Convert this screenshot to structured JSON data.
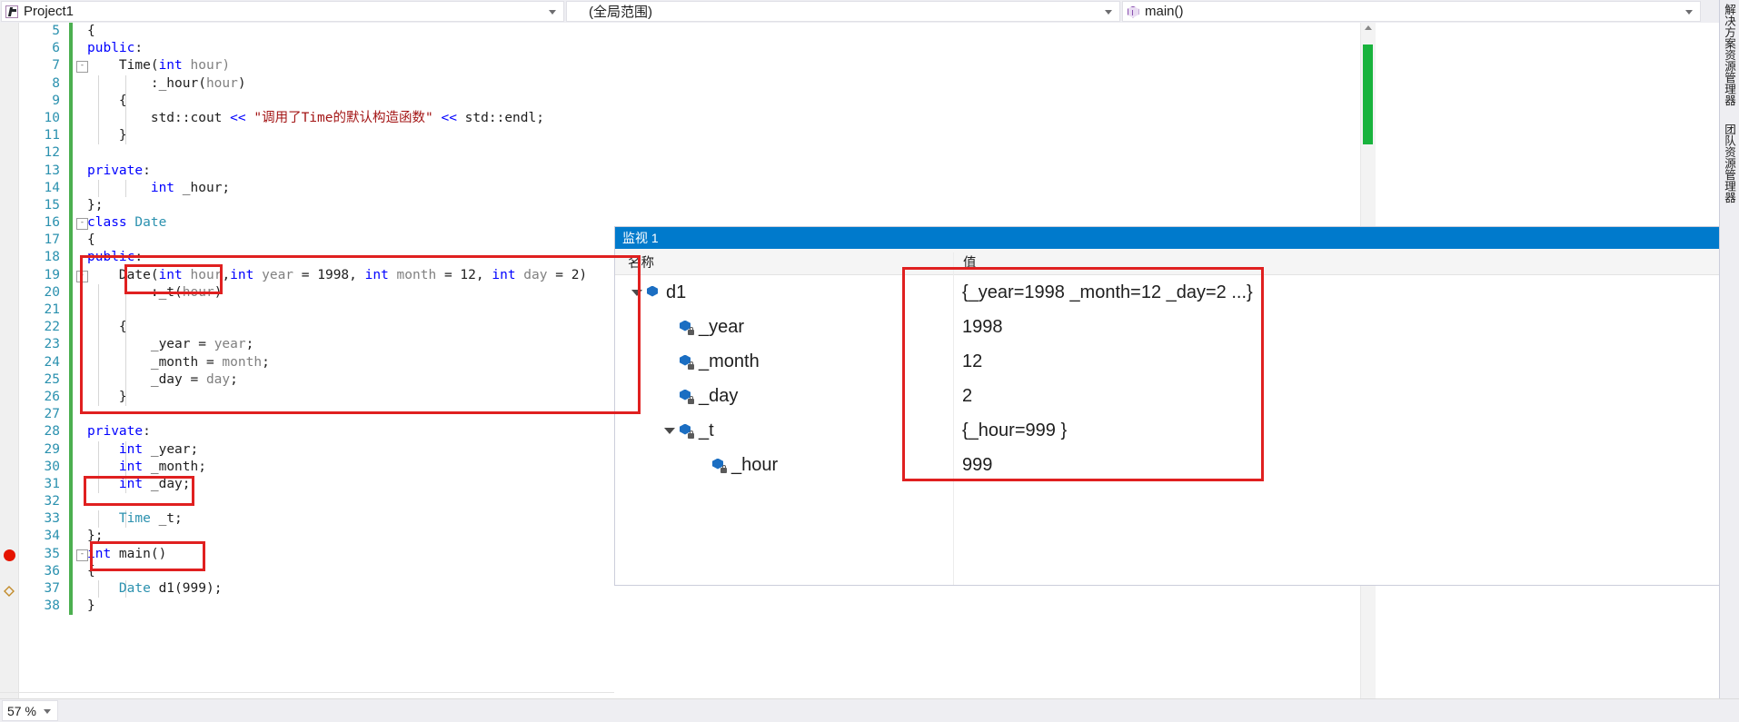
{
  "navbar": {
    "project": {
      "label": "Project1",
      "icon": "project-icon"
    },
    "scope": {
      "label": "(全局范围)"
    },
    "member": {
      "label": "main()",
      "icon": "method-cube-icon"
    }
  },
  "editor": {
    "first_line_number": 5,
    "lines": [
      {
        "num": 5,
        "indent": 0,
        "fold": "",
        "tokens": [
          {
            "t": "{",
            "c": "n"
          }
        ]
      },
      {
        "num": 6,
        "indent": 0,
        "fold": "",
        "tokens": [
          {
            "t": "public",
            "c": "k"
          },
          {
            "t": ":",
            "c": "n"
          }
        ]
      },
      {
        "num": 7,
        "indent": 0,
        "fold": "-",
        "tokens": [
          {
            "t": "    Time(",
            "c": "n"
          },
          {
            "t": "int",
            "c": "k"
          },
          {
            "t": " hour)",
            "c": "id"
          }
        ]
      },
      {
        "num": 8,
        "indent": 1,
        "fold": "",
        "tokens": [
          {
            "t": "        :_hour(",
            "c": "n"
          },
          {
            "t": "hour",
            "c": "id"
          },
          {
            "t": ")",
            "c": "n"
          }
        ]
      },
      {
        "num": 9,
        "indent": 1,
        "fold": "",
        "tokens": [
          {
            "t": "    {",
            "c": "n"
          }
        ]
      },
      {
        "num": 10,
        "indent": 1,
        "fold": "",
        "tokens": [
          {
            "t": "        std::cout ",
            "c": "n"
          },
          {
            "t": "<<",
            "c": "k"
          },
          {
            "t": " ",
            "c": "n"
          },
          {
            "t": "\"调用了Time的默认构造函数\"",
            "c": "s"
          },
          {
            "t": " ",
            "c": "n"
          },
          {
            "t": "<<",
            "c": "k"
          },
          {
            "t": " std::endl;",
            "c": "n"
          }
        ]
      },
      {
        "num": 11,
        "indent": 1,
        "fold": "",
        "tokens": [
          {
            "t": "    }",
            "c": "n"
          }
        ]
      },
      {
        "num": 12,
        "indent": 0,
        "fold": "",
        "tokens": []
      },
      {
        "num": 13,
        "indent": 0,
        "fold": "",
        "tokens": [
          {
            "t": "private",
            "c": "k"
          },
          {
            "t": ":",
            "c": "n"
          }
        ]
      },
      {
        "num": 14,
        "indent": 1,
        "fold": "",
        "tokens": [
          {
            "t": "        ",
            "c": "n"
          },
          {
            "t": "int",
            "c": "k"
          },
          {
            "t": " _hour;",
            "c": "n"
          }
        ]
      },
      {
        "num": 15,
        "indent": 0,
        "fold": "",
        "tokens": [
          {
            "t": "};",
            "c": "n"
          }
        ]
      },
      {
        "num": 16,
        "indent": 0,
        "fold": "-",
        "tokens": [
          {
            "t": "class",
            "c": "k"
          },
          {
            "t": " ",
            "c": "n"
          },
          {
            "t": "Date",
            "c": "t"
          }
        ]
      },
      {
        "num": 17,
        "indent": 0,
        "fold": "",
        "tokens": [
          {
            "t": "{",
            "c": "n"
          }
        ]
      },
      {
        "num": 18,
        "indent": 0,
        "fold": "",
        "tokens": [
          {
            "t": "public",
            "c": "k"
          },
          {
            "t": ":",
            "c": "n"
          }
        ]
      },
      {
        "num": 19,
        "indent": 0,
        "fold": "-",
        "tokens": [
          {
            "t": "    Date(",
            "c": "n"
          },
          {
            "t": "int",
            "c": "k"
          },
          {
            "t": " hour",
            "c": "id"
          },
          {
            "t": ",",
            "c": "n"
          },
          {
            "t": "int",
            "c": "k"
          },
          {
            "t": " year",
            "c": "id"
          },
          {
            "t": " = ",
            "c": "n"
          },
          {
            "t": "1998",
            "c": "num"
          },
          {
            "t": ", ",
            "c": "n"
          },
          {
            "t": "int",
            "c": "k"
          },
          {
            "t": " month",
            "c": "id"
          },
          {
            "t": " = ",
            "c": "n"
          },
          {
            "t": "12",
            "c": "num"
          },
          {
            "t": ", ",
            "c": "n"
          },
          {
            "t": "int",
            "c": "k"
          },
          {
            "t": " day",
            "c": "id"
          },
          {
            "t": " = ",
            "c": "n"
          },
          {
            "t": "2",
            "c": "num"
          },
          {
            "t": ")",
            "c": "n"
          }
        ]
      },
      {
        "num": 20,
        "indent": 1,
        "fold": "",
        "tokens": [
          {
            "t": "        :_t(",
            "c": "n"
          },
          {
            "t": "hour",
            "c": "id"
          },
          {
            "t": ")",
            "c": "n"
          }
        ]
      },
      {
        "num": 21,
        "indent": 1,
        "fold": "",
        "tokens": []
      },
      {
        "num": 22,
        "indent": 1,
        "fold": "",
        "tokens": [
          {
            "t": "    {",
            "c": "n"
          }
        ]
      },
      {
        "num": 23,
        "indent": 1,
        "fold": "",
        "tokens": [
          {
            "t": "        _year = ",
            "c": "n"
          },
          {
            "t": "year",
            "c": "id"
          },
          {
            "t": ";",
            "c": "n"
          }
        ]
      },
      {
        "num": 24,
        "indent": 1,
        "fold": "",
        "tokens": [
          {
            "t": "        _month = ",
            "c": "n"
          },
          {
            "t": "month",
            "c": "id"
          },
          {
            "t": ";",
            "c": "n"
          }
        ]
      },
      {
        "num": 25,
        "indent": 1,
        "fold": "",
        "tokens": [
          {
            "t": "        _day = ",
            "c": "n"
          },
          {
            "t": "day",
            "c": "id"
          },
          {
            "t": ";",
            "c": "n"
          }
        ]
      },
      {
        "num": 26,
        "indent": 1,
        "fold": "",
        "tokens": [
          {
            "t": "    }",
            "c": "n"
          }
        ]
      },
      {
        "num": 27,
        "indent": 0,
        "fold": "",
        "tokens": []
      },
      {
        "num": 28,
        "indent": 0,
        "fold": "",
        "tokens": [
          {
            "t": "private",
            "c": "k"
          },
          {
            "t": ":",
            "c": "n"
          }
        ]
      },
      {
        "num": 29,
        "indent": 1,
        "fold": "",
        "tokens": [
          {
            "t": "    ",
            "c": "n"
          },
          {
            "t": "int",
            "c": "k"
          },
          {
            "t": " _year;",
            "c": "n"
          }
        ]
      },
      {
        "num": 30,
        "indent": 1,
        "fold": "",
        "tokens": [
          {
            "t": "    ",
            "c": "n"
          },
          {
            "t": "int",
            "c": "k"
          },
          {
            "t": " _month;",
            "c": "n"
          }
        ]
      },
      {
        "num": 31,
        "indent": 1,
        "fold": "",
        "tokens": [
          {
            "t": "    ",
            "c": "n"
          },
          {
            "t": "int",
            "c": "k"
          },
          {
            "t": " _day;",
            "c": "n"
          }
        ]
      },
      {
        "num": 32,
        "indent": 0,
        "fold": "",
        "tokens": []
      },
      {
        "num": 33,
        "indent": 1,
        "fold": "",
        "tokens": [
          {
            "t": "    ",
            "c": "n"
          },
          {
            "t": "Time",
            "c": "t"
          },
          {
            "t": " _t;",
            "c": "n"
          }
        ]
      },
      {
        "num": 34,
        "indent": 0,
        "fold": "",
        "tokens": [
          {
            "t": "};",
            "c": "n"
          }
        ]
      },
      {
        "num": 35,
        "indent": 0,
        "fold": "-",
        "tokens": [
          {
            "t": "int",
            "c": "k"
          },
          {
            "t": " main()",
            "c": "n"
          }
        ]
      },
      {
        "num": 36,
        "indent": 0,
        "fold": "",
        "tokens": [
          {
            "t": "{",
            "c": "n"
          }
        ]
      },
      {
        "num": 37,
        "indent": 1,
        "fold": "",
        "tokens": [
          {
            "t": "    ",
            "c": "n"
          },
          {
            "t": "Date",
            "c": "t"
          },
          {
            "t": " d1(",
            "c": "n"
          },
          {
            "t": "999",
            "c": "num"
          },
          {
            "t": ");",
            "c": "n"
          }
        ]
      },
      {
        "num": 38,
        "indent": 0,
        "fold": "",
        "tokens": [
          {
            "t": "}",
            "c": "n"
          }
        ]
      }
    ],
    "breakpoint_line": 37,
    "current_stmt_line": 38
  },
  "watch": {
    "title": "监视 1",
    "columns": {
      "name": "名称",
      "value": "值"
    },
    "rows": [
      {
        "name": "d1",
        "value": "{_year=1998 _month=12 _day=2 ...}",
        "depth": 0,
        "expander": "expanded",
        "icon": "variable-icon"
      },
      {
        "name": "_year",
        "value": "1998",
        "depth": 1,
        "expander": "none",
        "icon": "private-field-icon"
      },
      {
        "name": "_month",
        "value": "12",
        "depth": 1,
        "expander": "none",
        "icon": "private-field-icon"
      },
      {
        "name": "_day",
        "value": "2",
        "depth": 1,
        "expander": "none",
        "icon": "private-field-icon"
      },
      {
        "name": "_t",
        "value": "{_hour=999 }",
        "depth": 1,
        "expander": "expanded",
        "icon": "private-field-icon"
      },
      {
        "name": "_hour",
        "value": "999",
        "depth": 2,
        "expander": "none",
        "icon": "private-field-icon"
      }
    ]
  },
  "right_tabs": [
    {
      "label": "解决方案资源管理器"
    },
    {
      "label": "团队资源管理器"
    }
  ],
  "statusbar": {
    "zoom": "57 %"
  },
  "annotations": {
    "accent_color": "#e02020",
    "boxes": [
      {
        "id": "ann-ctor",
        "target": "date-constructor-body"
      },
      {
        "id": "ann-init",
        "target": "member-init-list"
      },
      {
        "id": "ann-time-t",
        "target": "time-member-declaration"
      },
      {
        "id": "ann-date-d1",
        "target": "date-d1-instantiation"
      },
      {
        "id": "ann-values",
        "target": "watch-values-column"
      }
    ]
  },
  "colors": {
    "accent_blue": "#007acc",
    "chrome": "#eeeef2",
    "keyword": "#0000ff",
    "type": "#2b91af",
    "string": "#a31515",
    "identifier": "#808080",
    "changed_marker": "#4caf50",
    "breakpoint": "#e51400"
  }
}
